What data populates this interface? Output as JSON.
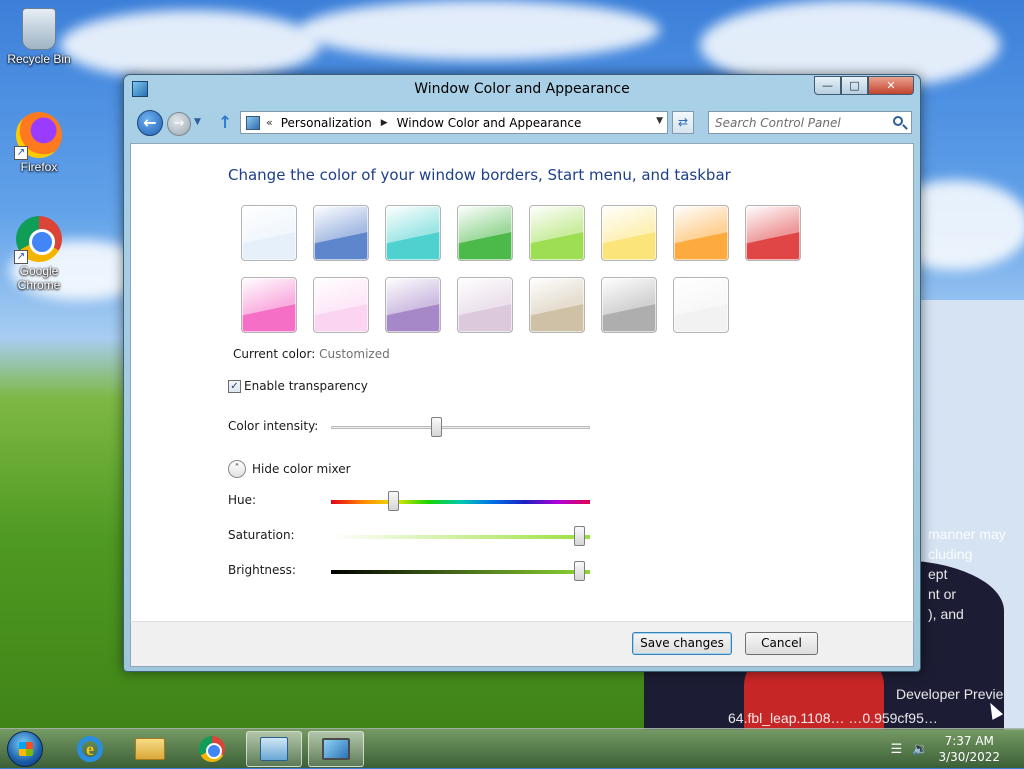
{
  "desktop": {
    "icons": [
      {
        "label": "Recycle Bin",
        "icon": "recycle-bin-icon"
      },
      {
        "label": "Firefox",
        "icon": "firefox-icon"
      },
      {
        "label": "Google Chrome",
        "icon": "chrome-icon"
      }
    ],
    "watermark_lines": [
      "manner may",
      "cluding",
      "ept",
      "nt or",
      "), and",
      "Developer Previe",
      "64.fbl_leap.1108… …0.959cf95…"
    ]
  },
  "window": {
    "title": "Window Color and Appearance",
    "caption": {
      "minimize": "—",
      "maximize": "□",
      "close": "✕"
    },
    "nav": {
      "back": "←",
      "forward": "→",
      "breadcrumb_chevron": "«",
      "breadcrumb": [
        "Personalization",
        "Window Color and Appearance"
      ],
      "breadcrumb_separator": "▶",
      "search_placeholder": "Search Control Panel"
    },
    "heading": "Change the color of your window borders, Start menu, and taskbar",
    "swatches": [
      {
        "name": "sky",
        "color": "#e6f0fb"
      },
      {
        "name": "twilight",
        "color": "#5d86cc"
      },
      {
        "name": "sea-foam",
        "color": "#4fd2cf"
      },
      {
        "name": "leaf",
        "color": "#4cba4a"
      },
      {
        "name": "lime",
        "color": "#9ede52"
      },
      {
        "name": "lemon",
        "color": "#fbe57a"
      },
      {
        "name": "orange",
        "color": "#fdab3e"
      },
      {
        "name": "ruby",
        "color": "#e04646"
      },
      {
        "name": "fuchsia",
        "color": "#f56fc7"
      },
      {
        "name": "blush",
        "color": "#fbd4f2"
      },
      {
        "name": "violet",
        "color": "#a688c8"
      },
      {
        "name": "lavender",
        "color": "#dcc9dc"
      },
      {
        "name": "taupe",
        "color": "#cfc1a6"
      },
      {
        "name": "slate",
        "color": "#aeaeae"
      },
      {
        "name": "frost",
        "color": "#f2f2f2"
      }
    ],
    "current_color_label": "Current color:",
    "current_color_value": "Customized",
    "enable_transparency": {
      "label": "Enable transparency",
      "checked": true,
      "check_glyph": "✓"
    },
    "color_intensity": {
      "label": "Color intensity:",
      "value_fraction": 0.4
    },
    "color_mixer": {
      "toggle_label": "Hide color mixer",
      "toggle_glyph": "˄",
      "hue": {
        "label": "Hue:",
        "value_fraction": 0.23
      },
      "saturation": {
        "label": "Saturation:",
        "value_fraction": 0.98
      },
      "brightness": {
        "label": "Brightness:",
        "value_fraction": 0.98
      }
    },
    "buttons": {
      "save": "Save changes",
      "cancel": "Cancel"
    }
  },
  "taskbar": {
    "items": [
      "start",
      "internet-explorer",
      "file-explorer",
      "chrome",
      "control-panel",
      "display-settings"
    ],
    "ie_glyph": "e",
    "tray": {
      "network_glyph": "☰",
      "volume_glyph": "🔉",
      "time": "7:37 AM",
      "date": "3/30/2022"
    }
  }
}
